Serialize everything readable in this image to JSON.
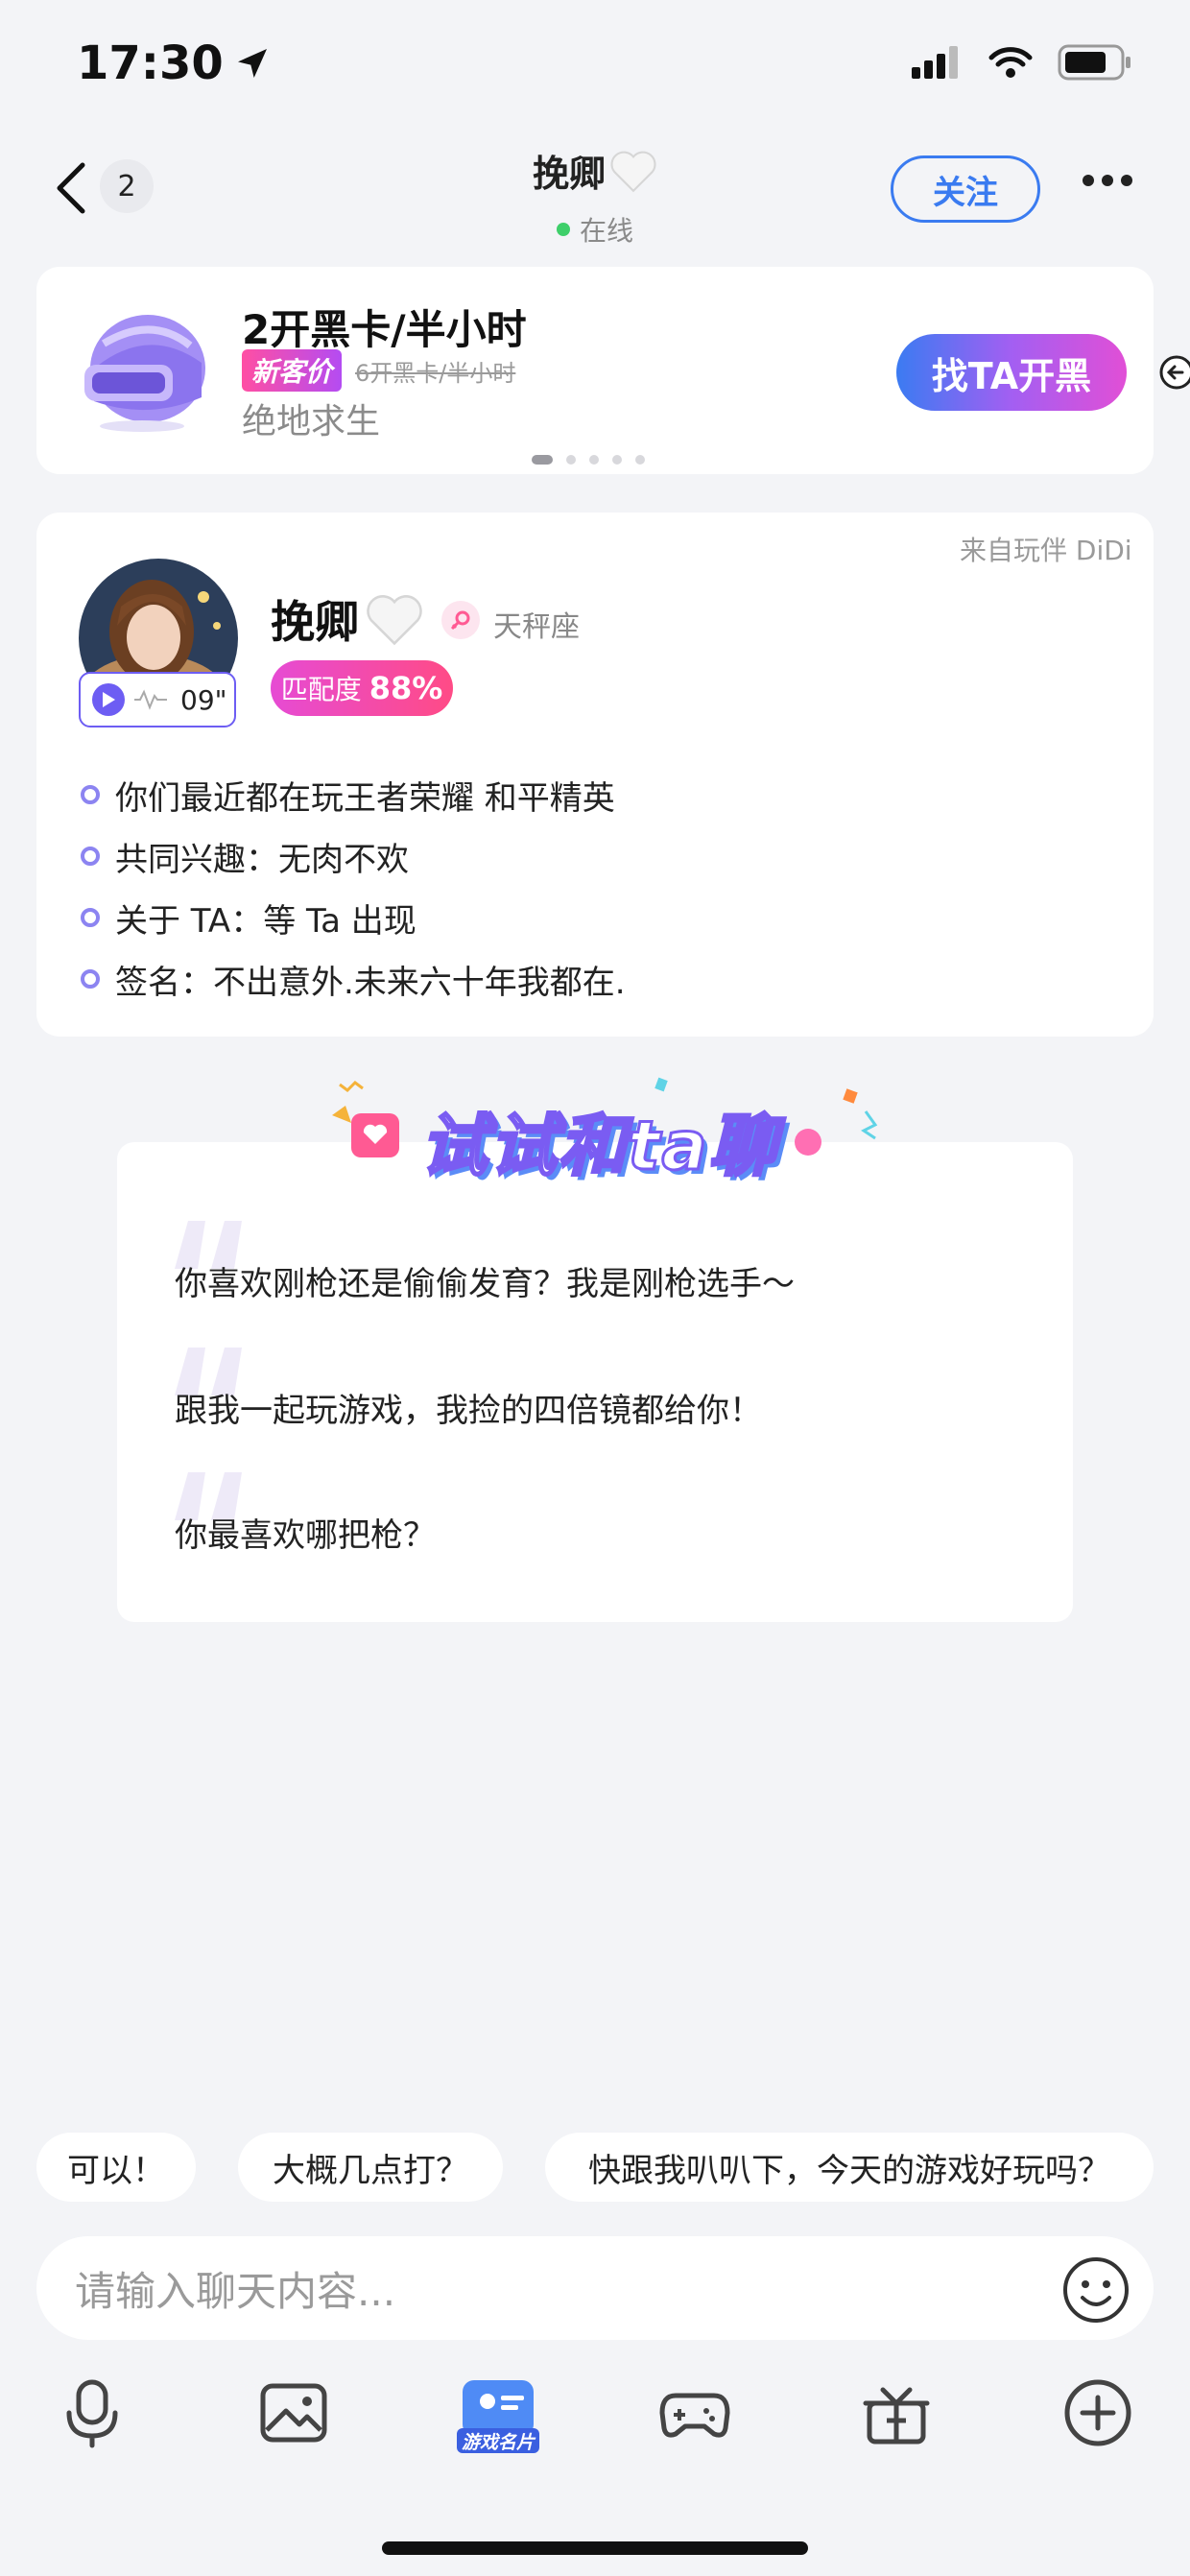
{
  "status_bar": {
    "time": "17:30"
  },
  "header": {
    "unread_count": "2",
    "title": "挽卿",
    "online_label": "在线",
    "follow_label": "关注"
  },
  "order": {
    "title": "2开黑卡/半小时",
    "new_price_tag": "新客价",
    "old_price": "6开黑卡/半小时",
    "game": "绝地求生",
    "cta": "找TA开黑"
  },
  "profile": {
    "source": "来自玩伴 DiDi",
    "name": "挽卿",
    "zodiac": "天秤座",
    "voice_duration": "09\"",
    "match_label": "匹配度",
    "match_value": "88%",
    "facts": [
      "你们最近都在玩王者荣耀 和平精英",
      "共同兴趣：无肉不欢",
      "关于 TA：等 Ta 出现",
      "签名：不出意外.未来六十年我都在."
    ]
  },
  "chat_prompts": {
    "banner": "试试和ta聊",
    "items": [
      "你喜欢刚枪还是偷偷发育？我是刚枪选手～",
      "跟我一起玩游戏，我捡的四倍镜都给你！",
      "你最喜欢哪把枪？"
    ]
  },
  "quick_replies": [
    "可以！",
    "大概几点打？",
    "快跟我叭叭下，今天的游戏好玩吗？"
  ],
  "input": {
    "placeholder": "请输入聊天内容..."
  },
  "toolbar": {
    "game_card_label": "游戏名片"
  },
  "colors": {
    "accent_blue": "#3a7bf0",
    "accent_purple": "#7a5cf2",
    "accent_pink": "#ff4b86"
  }
}
